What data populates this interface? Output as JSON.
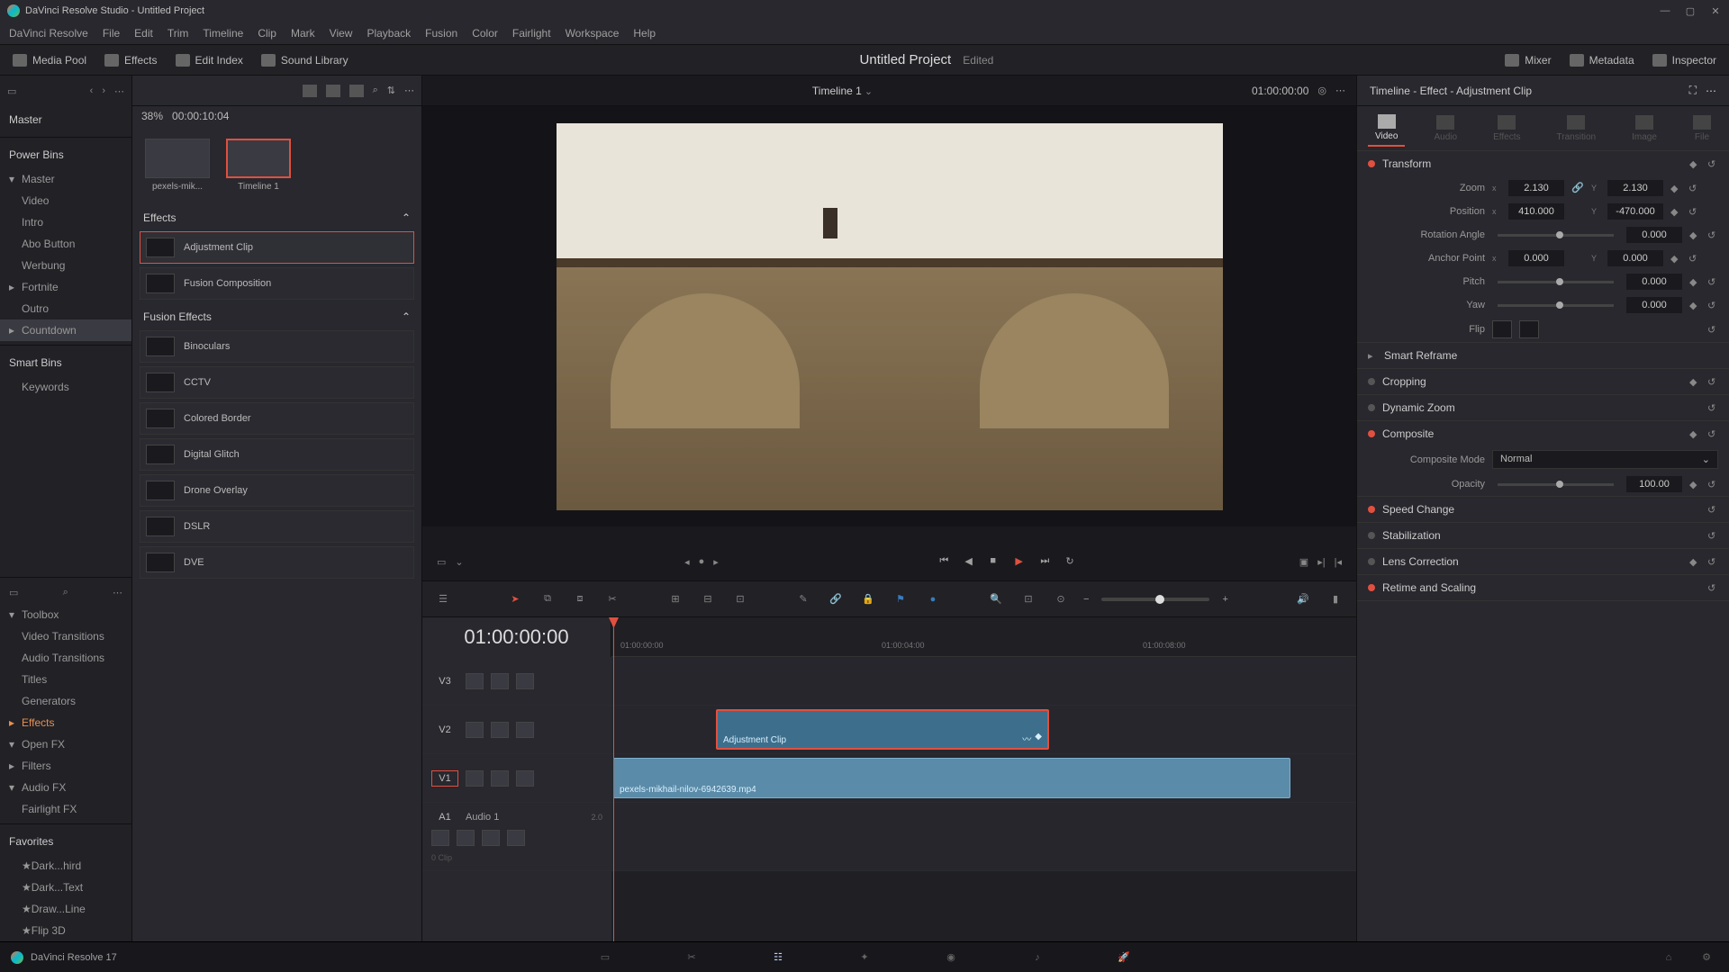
{
  "titlebar": {
    "text": "DaVinci Resolve Studio - Untitled Project"
  },
  "menu": [
    "DaVinci Resolve",
    "File",
    "Edit",
    "Trim",
    "Timeline",
    "Clip",
    "Mark",
    "View",
    "Playback",
    "Fusion",
    "Color",
    "Fairlight",
    "Workspace",
    "Help"
  ],
  "toolbar": {
    "media_pool": "Media Pool",
    "effects": "Effects",
    "edit_index": "Edit Index",
    "sound_library": "Sound Library",
    "mixer": "Mixer",
    "metadata": "Metadata",
    "inspector": "Inspector",
    "project_title": "Untitled Project",
    "project_status": "Edited"
  },
  "left": {
    "master": "Master",
    "power_bins": "Power Bins",
    "tree": [
      {
        "label": "Master",
        "chev": true
      },
      {
        "label": "Video"
      },
      {
        "label": "Intro"
      },
      {
        "label": "Abo Button"
      },
      {
        "label": "Werbung"
      },
      {
        "label": "Fortnite",
        "chev": true
      },
      {
        "label": "Outro"
      },
      {
        "label": "Countdown",
        "chev": true
      }
    ],
    "smart_bins": "Smart Bins",
    "keywords": "Keywords",
    "toolbox": "Toolbox",
    "toolbox_items": [
      "Video Transitions",
      "Audio Transitions",
      "Titles",
      "Generators",
      "Effects"
    ],
    "openfx": "Open FX",
    "filters": "Filters",
    "audiofx": "Audio FX",
    "fairlightfx": "Fairlight FX",
    "favorites": "Favorites",
    "fav_items": [
      "Dark...hird",
      "Dark...Text",
      "Draw...Line",
      "Flip 3D"
    ]
  },
  "midleft": {
    "zoom": "38%",
    "source_tc": "00:00:10:04",
    "thumbs": [
      {
        "label": "pexels-mik..."
      },
      {
        "label": "Timeline 1"
      }
    ],
    "effects_header": "Effects",
    "effects_list": [
      {
        "label": "Adjustment Clip",
        "selected": true
      },
      {
        "label": "Fusion Composition"
      }
    ],
    "fusion_header": "Fusion Effects",
    "fusion_list": [
      {
        "label": "Binoculars"
      },
      {
        "label": "CCTV"
      },
      {
        "label": "Colored Border"
      },
      {
        "label": "Digital Glitch"
      },
      {
        "label": "Drone Overlay"
      },
      {
        "label": "DSLR"
      },
      {
        "label": "DVE"
      }
    ]
  },
  "viewer": {
    "title": "Timeline 1",
    "record_tc": "01:00:00:00"
  },
  "timeline": {
    "tc_display": "01:00:00:00",
    "ruler_ticks": [
      "01:00:00:00",
      "01:00:04:00",
      "01:00:08:00"
    ],
    "tracks": {
      "v3": "V3",
      "v2": "V2",
      "v1": "V1",
      "a1": "A1",
      "a1_name": "Audio 1",
      "a1_ch": "2.0",
      "a1_clips": "0 Clip"
    },
    "clip_adjust": "Adjustment Clip",
    "clip_video": "pexels-mikhail-nilov-6942639.mp4"
  },
  "inspector": {
    "title": "Timeline - Effect - Adjustment Clip",
    "tabs": [
      "Video",
      "Audio",
      "Effects",
      "Transition",
      "Image",
      "File"
    ],
    "transform": {
      "title": "Transform",
      "zoom_label": "Zoom",
      "zoom_x": "2.130",
      "zoom_y": "2.130",
      "position_label": "Position",
      "pos_x": "410.000",
      "pos_y": "-470.000",
      "rotation_label": "Rotation Angle",
      "rotation": "0.000",
      "anchor_label": "Anchor Point",
      "anchor_x": "0.000",
      "anchor_y": "0.000",
      "pitch_label": "Pitch",
      "pitch": "0.000",
      "yaw_label": "Yaw",
      "yaw": "0.000",
      "flip_label": "Flip"
    },
    "sections": {
      "smart_reframe": "Smart Reframe",
      "cropping": "Cropping",
      "dynamic_zoom": "Dynamic Zoom",
      "composite": "Composite",
      "composite_mode_label": "Composite Mode",
      "composite_mode": "Normal",
      "opacity_label": "Opacity",
      "opacity": "100.00",
      "speed_change": "Speed Change",
      "stabilization": "Stabilization",
      "lens_correction": "Lens Correction",
      "retime": "Retime and Scaling"
    }
  },
  "bottom": {
    "app_version": "DaVinci Resolve 17"
  }
}
